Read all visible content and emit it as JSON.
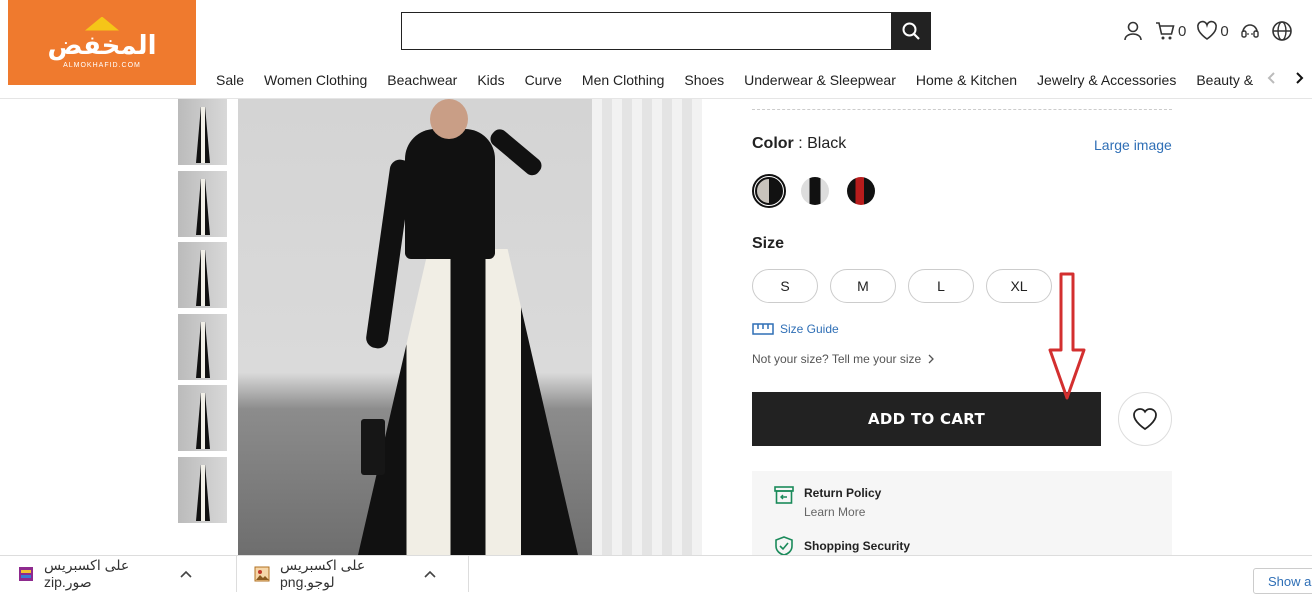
{
  "header": {
    "logo_text": "المخفض",
    "logo_sub": "ALMOKHAFID.COM",
    "search": {
      "value": "",
      "placeholder": ""
    },
    "cart_count": "0",
    "wishlist_count": "0"
  },
  "nav": {
    "items": [
      "Sale",
      "Women Clothing",
      "Beachwear",
      "Kids",
      "Curve",
      "Men Clothing",
      "Shoes",
      "Underwear & Sleepwear",
      "Home & Kitchen",
      "Jewelry & Accessories",
      "Beauty & Healt"
    ]
  },
  "product": {
    "color_label": "Color",
    "color_value": ": Black",
    "large_image": "Large image",
    "size_label": "Size",
    "sizes": [
      "S",
      "M",
      "L",
      "XL"
    ],
    "size_guide": "Size Guide",
    "not_your_size": "Not your size? Tell me your size",
    "add_to_cart": "ADD TO CART",
    "return_policy": "Return Policy",
    "learn_more": "Learn More",
    "shopping_security": "Shopping Security"
  },
  "downloads": {
    "items": [
      {
        "name": "على اكسبريس صور.zip"
      },
      {
        "name": "على اكسبريس لوجو.png"
      }
    ],
    "show_all": "Show all"
  },
  "colors": {
    "brand_orange": "#ef7a2e",
    "link_blue": "#2f6fb6",
    "annotation_red": "#d32f2f"
  }
}
